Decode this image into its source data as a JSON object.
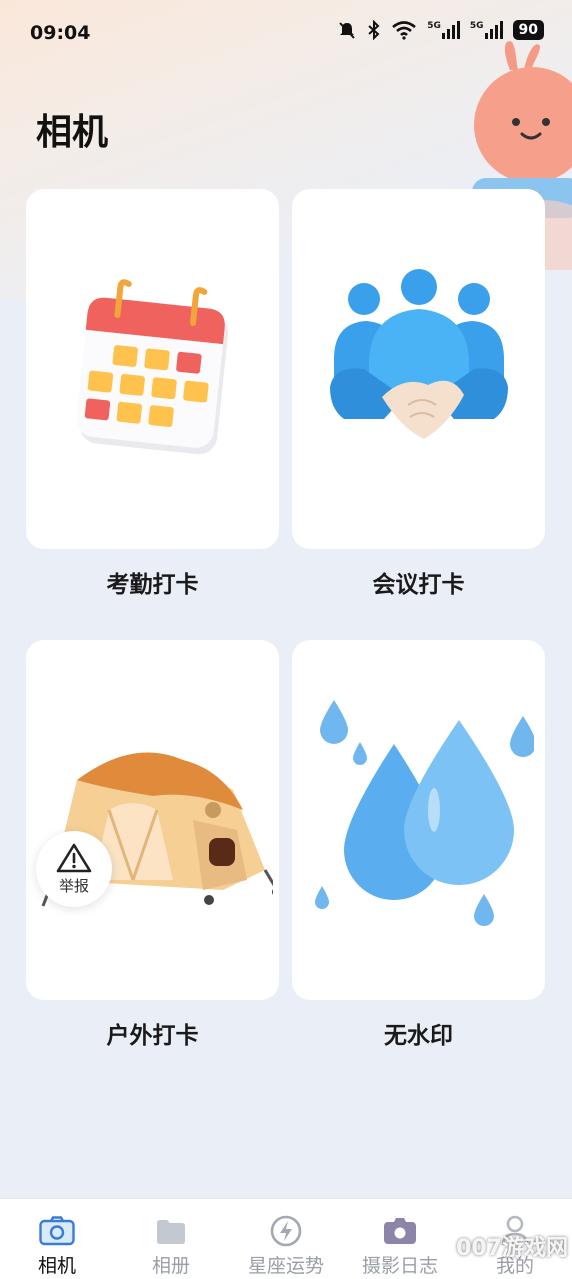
{
  "status_bar": {
    "time": "09:04",
    "battery": "90",
    "signal_1_label": "5G",
    "signal_2_label": "5G"
  },
  "page": {
    "title": "相机"
  },
  "cards": [
    {
      "label": "考勤打卡",
      "icon": "calendar-icon"
    },
    {
      "label": "会议打卡",
      "icon": "handshake-icon"
    },
    {
      "label": "户外打卡",
      "icon": "tent-icon"
    },
    {
      "label": "无水印",
      "icon": "water-drop-icon"
    }
  ],
  "report_badge": {
    "label": "举报",
    "icon": "warning-icon"
  },
  "bottom_nav": {
    "items": [
      {
        "label": "相机",
        "icon": "camera-icon",
        "active": true
      },
      {
        "label": "相册",
        "icon": "folder-icon",
        "active": false
      },
      {
        "label": "星座运势",
        "icon": "lightning-icon",
        "active": false
      },
      {
        "label": "摄影日志",
        "icon": "camera-log-icon",
        "active": false
      },
      {
        "label": "我的",
        "icon": "user-icon",
        "active": false
      }
    ]
  },
  "watermark": "007游戏网",
  "colors": {
    "accent": "#3a7bd5",
    "card_bg": "#ffffff",
    "page_bg": "#eaeef6"
  }
}
